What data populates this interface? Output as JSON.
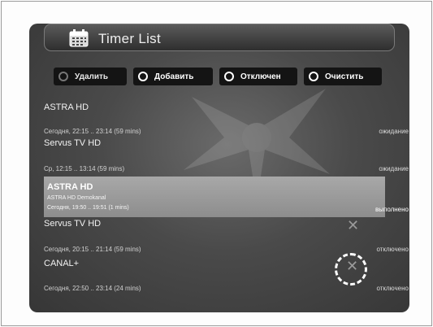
{
  "header": {
    "title": "Timer List",
    "icon": "calendar-icon"
  },
  "toolbar": {
    "buttons": [
      {
        "label": "Удалить",
        "ring_color": "#777777"
      },
      {
        "label": "Добавить",
        "ring_color": "#ffffff"
      },
      {
        "label": "Отключен",
        "ring_color": "#ffffff"
      },
      {
        "label": "Очистить",
        "ring_color": "#ffffff"
      }
    ]
  },
  "timers": [
    {
      "channel": "ASTRA HD",
      "time": "Сегодня, 22:15 .. 23:14 (59 mins)",
      "status": "ожидание"
    },
    {
      "channel": "Servus TV HD",
      "time": "Ср, 12:15 .. 13:14 (59 mins)",
      "status": "ожидание"
    },
    {
      "channel": "ASTRA HD",
      "subtitle": "ASTRA HD Demokanal",
      "time": "Сегодня, 19:50 .. 19:51 (1 mins)",
      "status": "выполнено",
      "selected": true
    },
    {
      "channel": "Servus TV HD",
      "time": "Сегодня, 20:15 .. 21:14 (59 mins)",
      "status": "отключено",
      "icon": "close-icon"
    },
    {
      "channel": "CANAL+",
      "time": "Сегодня, 22:50 .. 23:14 (24 mins)",
      "status": "отключено",
      "icon": "close-icon"
    }
  ],
  "colors": {
    "selected_row": "#9a9a9a",
    "button_bg": "#141414",
    "screen_bg": "#454545"
  }
}
